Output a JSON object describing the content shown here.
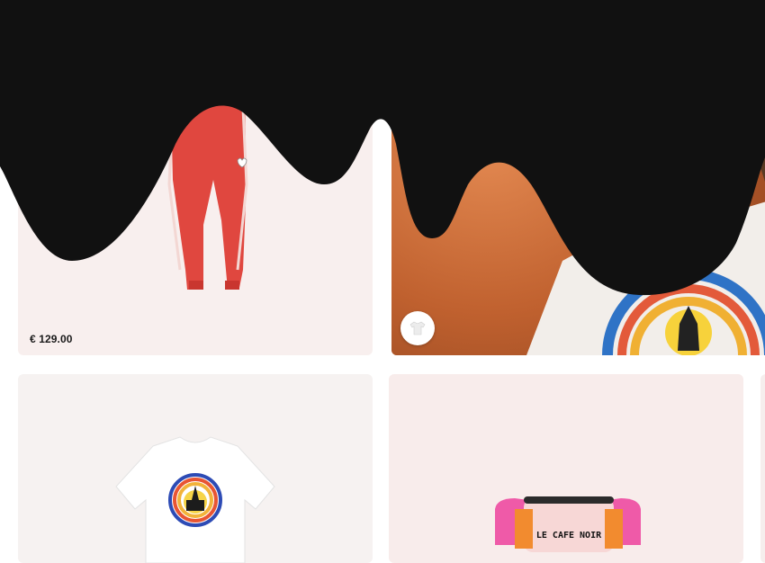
{
  "products": [
    {
      "name": "red-track-pants",
      "price": "€ 129.00",
      "icon": "red-track-pants-image"
    },
    {
      "name": "lifestyle-photo",
      "icon": "model-wearing-tee-photo",
      "thumbnail_icon": "tshirt-thumbnail-icon"
    },
    {
      "name": "white-graphic-tee",
      "icon": "white-tshirt-image"
    },
    {
      "name": "neon-belt-bag",
      "icon": "belt-bag-image",
      "print_text": "LE CAFE NOIR"
    }
  ],
  "colors": {
    "drip": "#111111",
    "card_tint": "#f8efee",
    "pants_red": "#e0473f",
    "photo_orange": "#c86a3c"
  }
}
